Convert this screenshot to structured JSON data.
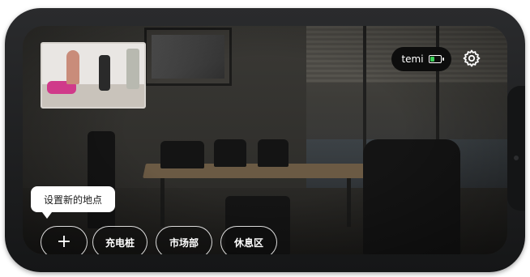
{
  "status": {
    "robot_name": "temi",
    "battery_level": 0.45,
    "battery_color": "#3ed05a"
  },
  "icons": {
    "settings": "gear-icon",
    "battery": "battery-icon",
    "add": "plus-icon"
  },
  "tooltip": {
    "text": "设置新的地点"
  },
  "locations": [
    {
      "label": "充电桩"
    },
    {
      "label": "市场部"
    },
    {
      "label": "休息区"
    }
  ],
  "add_button": {
    "label": "+"
  }
}
